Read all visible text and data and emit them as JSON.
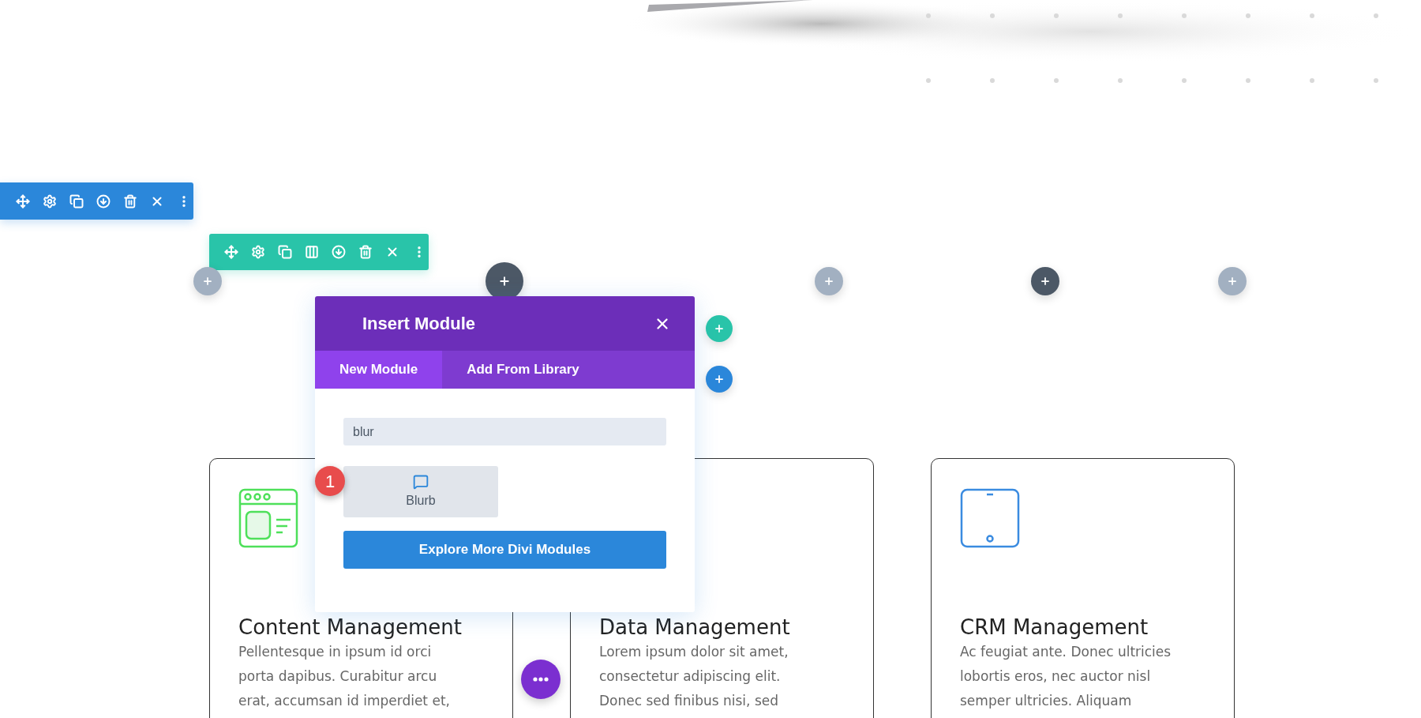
{
  "modal": {
    "title": "Insert Module",
    "tabs": [
      {
        "label": "New Module",
        "selected": true
      },
      {
        "label": "Add From Library",
        "selected": false
      }
    ],
    "search": {
      "value": "blur"
    },
    "results": [
      {
        "label": "Blurb",
        "badge": "1"
      }
    ],
    "explore_button": "Explore More Divi Modules"
  },
  "cards": [
    {
      "kind": "browser",
      "title": "Content Management",
      "lines": [
        "Pellentesque in ipsum id orci",
        "porta dapibus. Curabitur arcu",
        "erat, accumsan id imperdiet et,"
      ]
    },
    {
      "title": "Data Management",
      "lines": [
        "Lorem ipsum dolor sit amet,",
        "consectetur adipiscing elit.",
        "Donec sed finibus nisi, sed"
      ]
    },
    {
      "kind": "tablet",
      "title": "CRM Management",
      "lines": [
        "Ac feugiat ante. Donec ultricies",
        "lobortis eros, nec auctor nisl",
        "semper ultricies. Aliquam"
      ]
    }
  ]
}
